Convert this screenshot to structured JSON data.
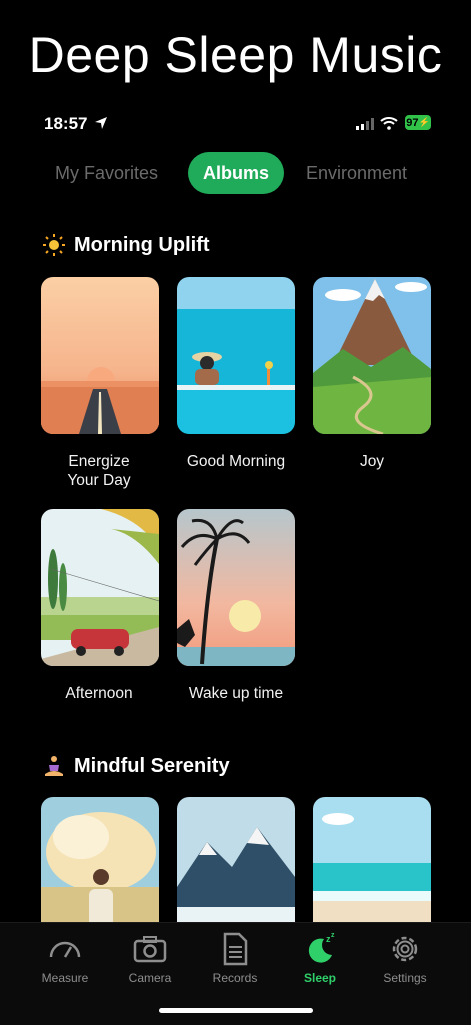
{
  "banner": {
    "title": "Deep Sleep Music"
  },
  "status": {
    "time": "18:57",
    "battery": "97"
  },
  "tabs": [
    {
      "label": "My Favorites"
    },
    {
      "label": "Albums",
      "active": true
    },
    {
      "label": "Environment"
    }
  ],
  "sections": [
    {
      "title": "Morning Uplift",
      "icon": "sun-icon",
      "albums": [
        {
          "label": "Energize\nYour Day"
        },
        {
          "label": "Good Morning"
        },
        {
          "label": "Joy"
        },
        {
          "label": "Afternoon"
        },
        {
          "label": "Wake up time"
        }
      ]
    },
    {
      "title": "Mindful Serenity",
      "icon": "meditation-icon",
      "albums": [
        {},
        {},
        {}
      ]
    }
  ],
  "tabbar": [
    {
      "label": "Measure",
      "icon": "gauge-icon"
    },
    {
      "label": "Camera",
      "icon": "camera-icon"
    },
    {
      "label": "Records",
      "icon": "document-icon"
    },
    {
      "label": "Sleep",
      "icon": "moon-zzz-icon",
      "active": true
    },
    {
      "label": "Settings",
      "icon": "gear-icon"
    }
  ],
  "colors": {
    "accent": "#1fab5a",
    "active_tab_icon": "#2fd06a"
  }
}
